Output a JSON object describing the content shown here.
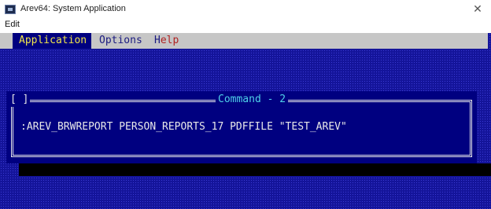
{
  "window": {
    "title": "Arev64: System Application",
    "close_glyph": "✕"
  },
  "menubar": {
    "edit_label": "Edit"
  },
  "app_menu": {
    "items": [
      {
        "first": "A",
        "rest": "pplication"
      },
      {
        "first": "O",
        "rest": "ptions"
      },
      {
        "first": "H",
        "rest": "elp"
      }
    ]
  },
  "dialog": {
    "close_tag": "[ ]",
    "title": "Command - 2",
    "command_text": ":AREV_BRWREPORT PERSON_REPORTS_17 PDFFILE \"TEST_AREV\""
  },
  "colors": {
    "screen_bg": "#14149a",
    "dialog_bg": "#000080",
    "menu_bg": "#c6c6c6",
    "highlight_text": "#f1e54a",
    "title_cyan": "#4fd0e8"
  }
}
